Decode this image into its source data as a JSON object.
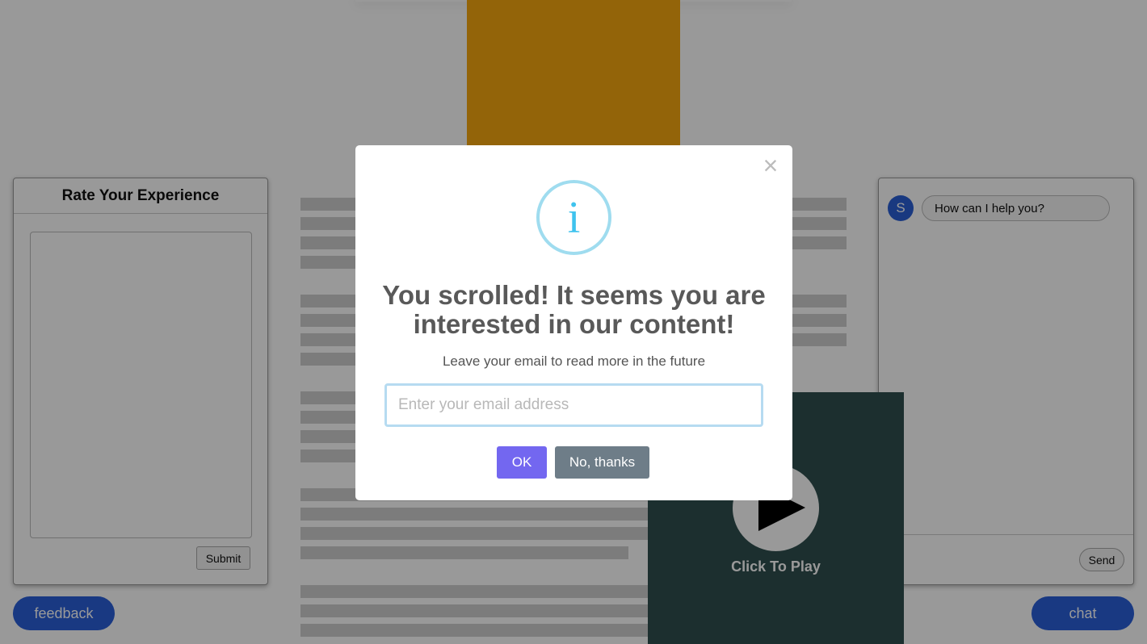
{
  "colors": {
    "hero_image": "#f5a70f",
    "video_bg": "#2f4f4f",
    "pill_button": "#2b5fd9",
    "ok_button": "#7367f0",
    "no_button": "#6e7d88",
    "info_icon": "#3fc3ee",
    "overlay": "rgba(0,0,0,0.4)"
  },
  "feedback_panel": {
    "title": "Rate Your Experience",
    "submit_label": "Submit"
  },
  "chat_panel": {
    "avatar_initial": "S",
    "message": "How can I help you?",
    "send_label": "Send"
  },
  "floating": {
    "feedback_label": "feedback",
    "chat_label": "chat"
  },
  "video": {
    "label": "Click To Play",
    "icon": "play-icon"
  },
  "modal": {
    "icon": "info-icon",
    "icon_glyph": "i",
    "close_glyph": "×",
    "title": "You scrolled! It seems you are interested in our content!",
    "text": "Leave your email to read more in the future",
    "email_placeholder": "Enter your email address",
    "ok_label": "OK",
    "no_label": "No, thanks"
  }
}
